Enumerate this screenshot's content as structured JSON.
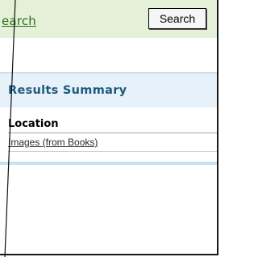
{
  "search": {
    "link_text": "earch",
    "button_label": "Search"
  },
  "results": {
    "title": "Results Summary",
    "column_header": "Location",
    "rows": [
      {
        "label": "Images (from Books)"
      }
    ]
  },
  "colors": {
    "search_bar_bg": "#e4f1d8",
    "results_header_bg": "#e6f1fa",
    "accent_blue": "#1f5a7a",
    "link_green": "#2e6b1f"
  }
}
